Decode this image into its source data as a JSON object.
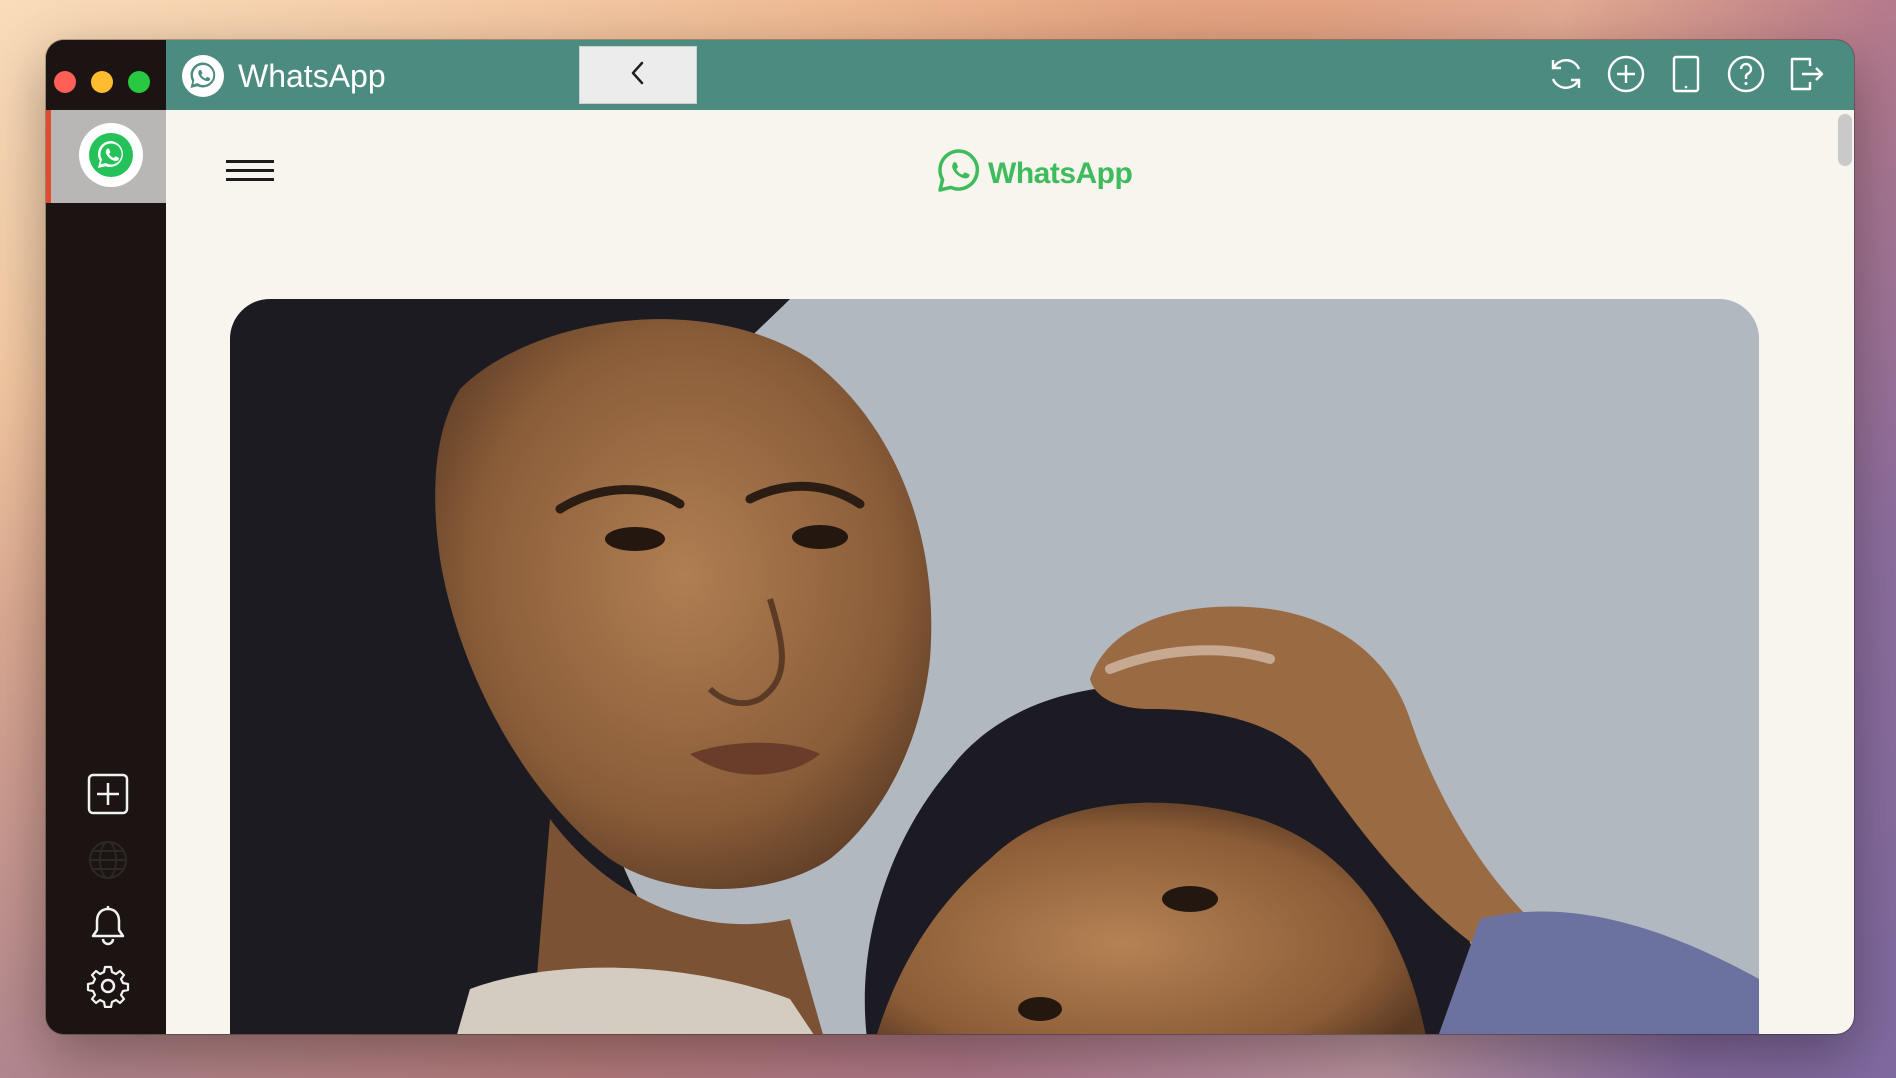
{
  "window": {
    "title": "WhatsApp",
    "titlebar_color": "#4c8b7f",
    "traffic_lights": [
      "close",
      "minimize",
      "maximize"
    ]
  },
  "titlebar": {
    "app_name": "WhatsApp",
    "back_icon": "chevron-left-icon",
    "actions": [
      {
        "name": "refresh-icon"
      },
      {
        "name": "add-circle-icon"
      },
      {
        "name": "tablet-icon"
      },
      {
        "name": "help-icon"
      },
      {
        "name": "logout-icon"
      }
    ]
  },
  "sidebar": {
    "active_app": "whatsapp-icon",
    "active_indicator_color": "#e04a2f",
    "tools": [
      {
        "name": "add-square-icon"
      },
      {
        "name": "globe-icon"
      },
      {
        "name": "bell-icon"
      },
      {
        "name": "gear-icon"
      }
    ]
  },
  "page": {
    "menu_icon": "hamburger-icon",
    "brand": "WhatsApp",
    "brand_color": "#3dbb5d",
    "hero_image": "photo of mother and daughter"
  }
}
